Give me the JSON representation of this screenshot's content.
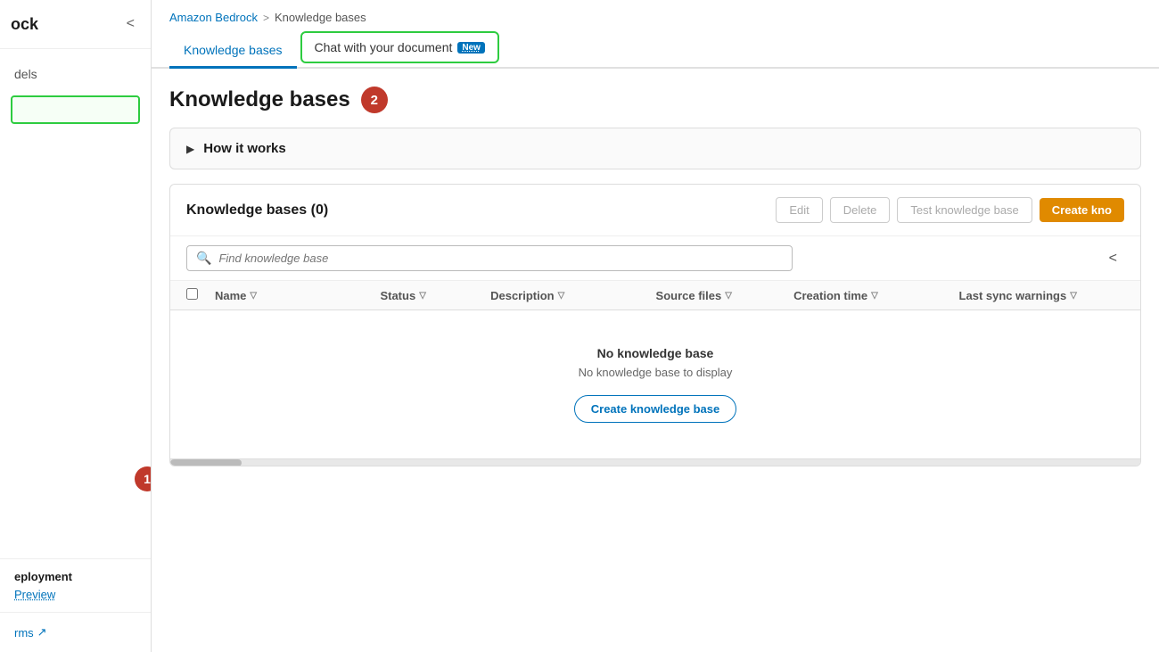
{
  "sidebar": {
    "title": "ock",
    "collapse_label": "<",
    "nav_items": [
      {
        "label": "dels"
      }
    ],
    "green_box": true,
    "badge_1": "1",
    "deployment_label": "eployment",
    "preview_link": "Preview",
    "footer_link": "rms",
    "footer_icon": "↗"
  },
  "breadcrumb": {
    "link": "Amazon Bedrock",
    "separator": ">",
    "current": "Knowledge bases"
  },
  "tabs": {
    "tab1_label": "Knowledge bases",
    "tab2_label": "Chat with your document",
    "tab2_badge": "New"
  },
  "page": {
    "title": "Knowledge bases",
    "badge_2": "2"
  },
  "how_it_works": {
    "arrow": "▶",
    "label": "How it works"
  },
  "table_card": {
    "title": "Knowledge bases",
    "count": "(0)",
    "btn_edit": "Edit",
    "btn_delete": "Delete",
    "btn_test": "Test knowledge base",
    "btn_create": "Create kno",
    "search_placeholder": "Find knowledge base",
    "columns": [
      {
        "label": "Name",
        "key": "name"
      },
      {
        "label": "Status",
        "key": "status"
      },
      {
        "label": "Description",
        "key": "description"
      },
      {
        "label": "Source files",
        "key": "source_files"
      },
      {
        "label": "Creation time",
        "key": "creation_time"
      },
      {
        "label": "Last sync warnings",
        "key": "last_sync"
      }
    ],
    "empty_title": "No knowledge base",
    "empty_subtitle": "No knowledge base to display",
    "empty_btn": "Create knowledge base"
  },
  "colors": {
    "accent_blue": "#0073bb",
    "accent_orange": "#e08a00",
    "badge_red": "#c0392b",
    "green_border": "#2ecc40"
  }
}
